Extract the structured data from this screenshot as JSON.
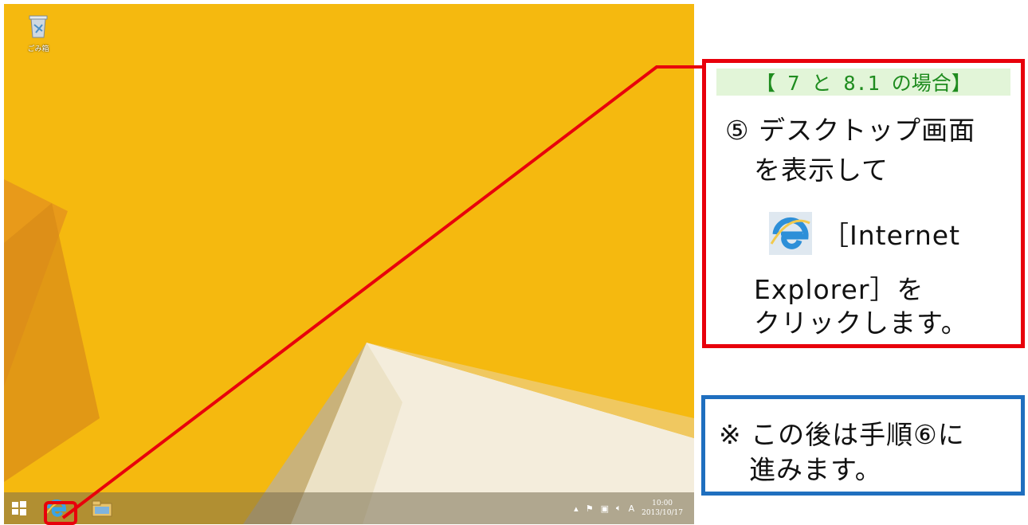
{
  "desktop": {
    "recycle_bin_label": "ごみ箱"
  },
  "taskbar": {
    "start": "start-button",
    "apps": [
      "internet-explorer",
      "file-explorer"
    ],
    "clock_time": "10:00",
    "clock_date": "2013/10/17",
    "ime_indicator": "A"
  },
  "callout": {
    "header": "【 7 と 8.1 の場合】",
    "line1": "⑤ デスクトップ画面",
    "line2": "を表示して",
    "line3": "［Internet",
    "line4": "Explorer］を",
    "line5": "クリックします。"
  },
  "note": {
    "line1": "※ この後は手順⑥に",
    "line2": "進みます。"
  },
  "colors": {
    "callout_border": "#e8000b",
    "note_border": "#1f6fbf",
    "header_bg": "#e2f5d8",
    "header_text": "#1f8c1f",
    "wallpaper": "#f5b90f"
  }
}
